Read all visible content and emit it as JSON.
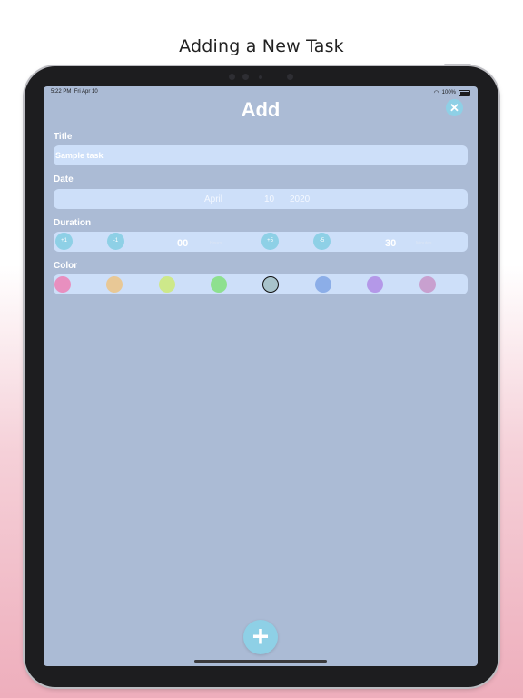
{
  "caption": "Adding a New Task",
  "status_bar": {
    "time": "5:22 PM",
    "date": "Fri Apr 10",
    "battery": "100%"
  },
  "header": {
    "title": "Add",
    "close_icon": "close-x"
  },
  "form": {
    "title": {
      "label": "Title",
      "placeholder": "Sample task"
    },
    "date": {
      "label": "Date",
      "month": "April",
      "day": "10",
      "year": "2020"
    },
    "duration": {
      "label": "Duration",
      "hour_inc": "+1",
      "hour_dec": "-1",
      "hours_value": "00",
      "hours_unit": "Hours",
      "min_inc": "+5",
      "min_dec": "-5",
      "minutes_value": "30",
      "minutes_unit": "Minutes"
    },
    "color": {
      "label": "Color",
      "swatches": [
        "#e88fbf",
        "#e8c896",
        "#cde88a",
        "#8ee08f",
        "#a8c3cb",
        "#8caee8",
        "#b498e8",
        "#c8a0cf"
      ],
      "selected_index": 4
    }
  },
  "fab": {
    "icon": "plus"
  },
  "colors": {
    "screen_bg": "#abbbd5",
    "field_bg": "#cddff9",
    "accent": "#8ed0e6"
  }
}
